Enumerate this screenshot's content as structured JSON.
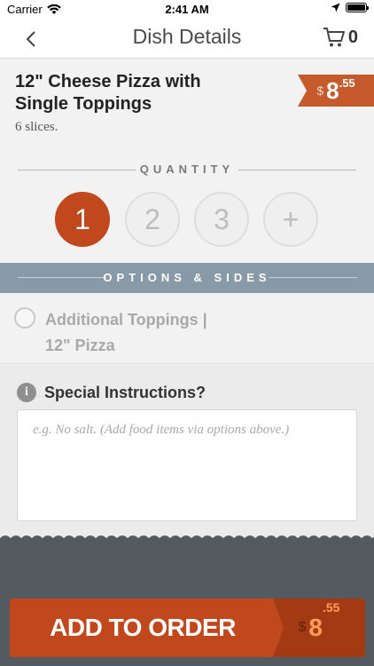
{
  "status_bar": {
    "carrier": "Carrier",
    "time": "2:41 AM"
  },
  "nav": {
    "title": "Dish Details",
    "cart_count": "0"
  },
  "dish": {
    "name": "12\" Cheese Pizza with Single Toppings",
    "description": "6 slices.",
    "price": {
      "currency": "$",
      "major": "8",
      "minor": ".55"
    }
  },
  "quantity": {
    "label": "QUANTITY",
    "options": [
      "1",
      "2",
      "3",
      "+"
    ],
    "selected": "1"
  },
  "options_sides": {
    "label": "OPTIONS & SIDES",
    "items": [
      {
        "label": "Additional Toppings | 12\" Pizza",
        "selected": false
      }
    ]
  },
  "instructions": {
    "label": "Special Instructions?",
    "placeholder": "e.g. No salt. (Add food items via options above.)",
    "value": ""
  },
  "add_button": {
    "label": "ADD TO ORDER",
    "price": {
      "currency": "$",
      "major": "8",
      "minor": ".55"
    }
  },
  "colors": {
    "accent": "#c0481c",
    "options_bar": "#889aa8",
    "footer": "#535b61"
  }
}
